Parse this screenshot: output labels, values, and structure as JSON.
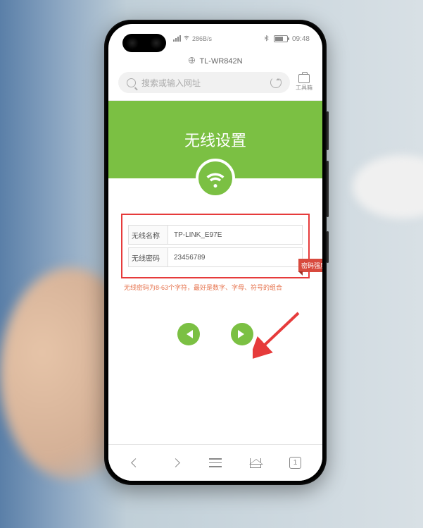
{
  "status": {
    "net_speed": "286B/s",
    "time": "09:48"
  },
  "browser": {
    "page_title": "TL-WR842N",
    "search_placeholder": "搜索或输入网址",
    "toolbox_label": "工具箱"
  },
  "page": {
    "header_title": "无线设置",
    "fields": {
      "ssid_label": "无线名称",
      "ssid_value": "TP-LINK_E97E",
      "pwd_label": "无线密码",
      "pwd_value": "23456789"
    },
    "hint": "无线密码为8-63个字符，最好是数字、字母、符号的组合",
    "strength_label": "密码强度"
  },
  "bottom_nav": {
    "tab_count": "1"
  }
}
